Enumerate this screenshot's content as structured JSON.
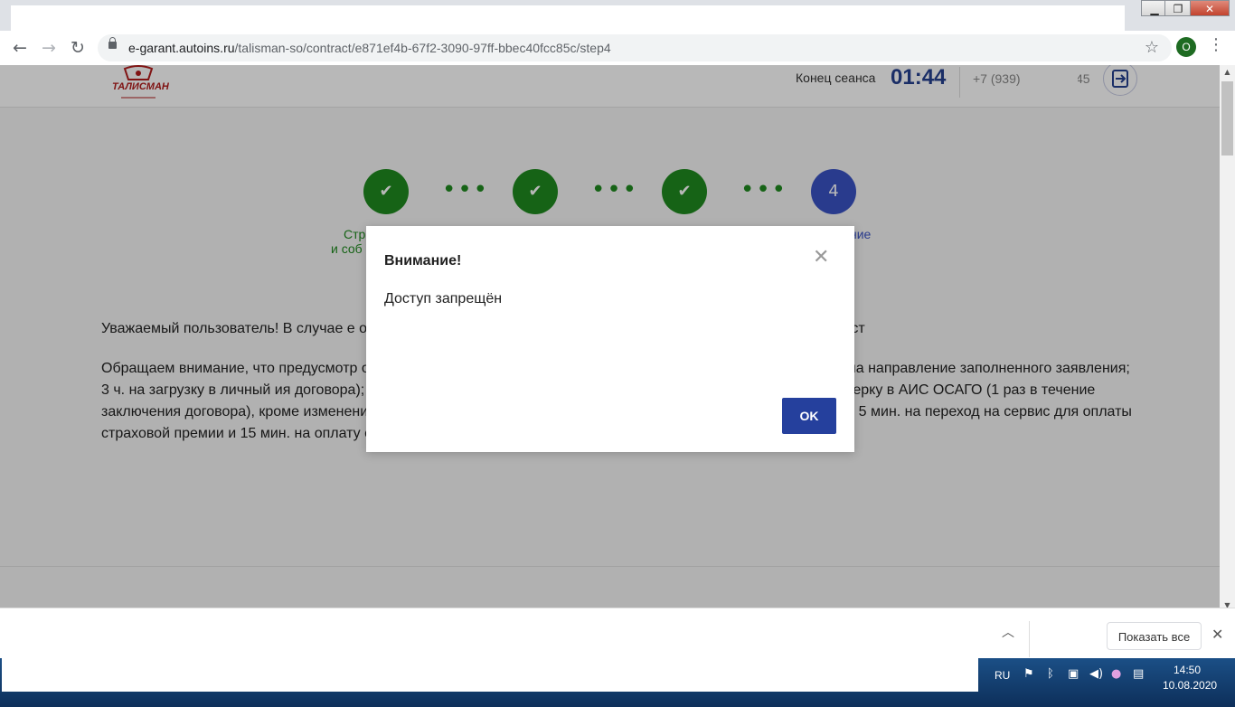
{
  "browser": {
    "url_host": "e-garant.autoins.ru",
    "url_path": "/talisman-so/contract/e871ef4b-67f2-3090-97ff-bbec40fcc85c/step4",
    "profile_initial": "O"
  },
  "header": {
    "logo_text": "ТАЛИСМАН",
    "session_label": "Конец сеанса",
    "session_timer": "01:44",
    "phone": "+7 (939)",
    "phone_tail": "45"
  },
  "steps": [
    {
      "state": "done",
      "label_fragment": "Стр"
    },
    {
      "state": "done",
      "label_fragment": ""
    },
    {
      "state": "done",
      "label_fragment": ""
    },
    {
      "state": "active",
      "number": "4",
      "label_fragment": "ние"
    }
  ],
  "step_label_1_line2": "и соб",
  "content": {
    "para1": "Уважаемый пользователь! В случае е                                                                                          оплаты заключения договора ОСАГО в виде электронного документа, дост",
    "para2": "Обращаем внимание, что предусмотр                                                                                    ормлении договора ОСАГО в виде электронного документа с Обеспечи                                                                          на направление заполненного заявления; 3 ч. на загрузку в личный                                                                          ия договора); 18 мин. на изменение не более 3 полей заявления, не прошедших проверку в АИС ОСАГО (1 раз в течение заключения договора), кроме изменения данных страхователя и адреса собственника транспортного средства; 5 мин. на переход на сервис для оплаты страховой премии и 15 мин. на оплату страховой премии."
  },
  "modal": {
    "title": "Внимание!",
    "body": "Доступ запрещён",
    "ok_label": "OK"
  },
  "downloads": {
    "show_all_label": "Показать все"
  },
  "taskbar": {
    "lang": "RU",
    "time": "14:50",
    "date": "10.08.2020"
  }
}
